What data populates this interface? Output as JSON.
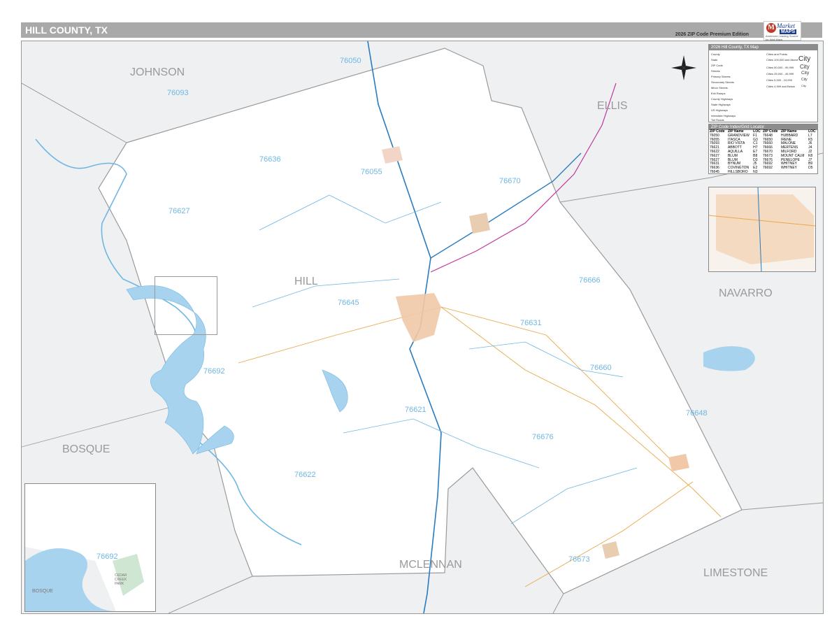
{
  "header": {
    "title": "HILL COUNTY, TX",
    "edition": "2026 ZIP Code Premium Edition",
    "logo_brand_top": "Market",
    "logo_brand_bottom": "MAPS",
    "logo_tagline": "America's Leading Source for Wall Maps"
  },
  "legend": {
    "title": "2026 Hill County, TX Map",
    "items": [
      "County",
      "State",
      "ZIP Code",
      "Streets",
      "Primary Streets",
      "Secondary Streets",
      "Minor Streets",
      "Exit Ramps",
      "County Highways",
      "State Highways",
      "US Highways",
      "Interstate Highways",
      "Toll Roads"
    ],
    "cities_title": "Cities and Points",
    "city_classes": [
      "Cities 100,000 and Above",
      "Cities 50,000 - 99,999",
      "Cities 25,000 - 49,999",
      "Cities 5,000 - 24,999",
      "Cities 4,999 and Below"
    ],
    "city_samples": [
      "City",
      "City",
      "City",
      "City",
      "City"
    ],
    "colors": {
      "county": "#9a9a9a",
      "zip": "#6fb7e3",
      "us_highway": "#c0399c",
      "interstate": "#2a7bbf",
      "toll": "#2fa84f",
      "state": "#e8a94a"
    }
  },
  "zip_index": {
    "title": "ZIP Code Index/Grid Locator",
    "headers": [
      "ZIP Code",
      "ZIP Name",
      "LOC",
      "ZIP Code",
      "ZIP Name",
      "LOC"
    ],
    "rows": [
      [
        "76050",
        "GRANDVIEW",
        "F1",
        "76648",
        "HUBBARD",
        "L7"
      ],
      [
        "76055",
        "ITASCA",
        "G3",
        "76650",
        "IRENE",
        "K5"
      ],
      [
        "76093",
        "RIO VISTA",
        "C1",
        "76660",
        "MALONE",
        "J6"
      ],
      [
        "76621",
        "ABBOTT",
        "H7",
        "76666",
        "MERTENS",
        "J4"
      ],
      [
        "76622",
        "AQUILLA",
        "E7",
        "76670",
        "MILFORD",
        "J2"
      ],
      [
        "76627",
        "BLUM",
        "B8",
        "76673",
        "MOUNT CALM",
        "K8"
      ],
      [
        "76627",
        "BLUM",
        "D3",
        "76676",
        "PENELOPE",
        "J7"
      ],
      [
        "76631",
        "BYNUM",
        "J5",
        "76692",
        "WHITNEY",
        "B9"
      ],
      [
        "76636",
        "COVINGTON",
        "E2",
        "76692",
        "WHITNEY",
        "D5"
      ],
      [
        "76645",
        "HILLSBORO",
        "N3",
        "",
        "",
        ""
      ]
    ]
  },
  "map": {
    "counties": [
      "JOHNSON",
      "ELLIS",
      "HILL",
      "NAVARRO",
      "BOSQUE",
      "MCLENNAN",
      "LIMESTONE"
    ],
    "zips": [
      "76050",
      "76093",
      "76636",
      "76055",
      "76670",
      "76627",
      "76645",
      "76666",
      "76631",
      "76692",
      "76660",
      "76621",
      "76648",
      "76676",
      "76622",
      "76673"
    ]
  },
  "inset_bottom_left": {
    "labels": [
      "76692",
      "CEDAR CREEK PARK",
      "BOSQUE"
    ]
  }
}
